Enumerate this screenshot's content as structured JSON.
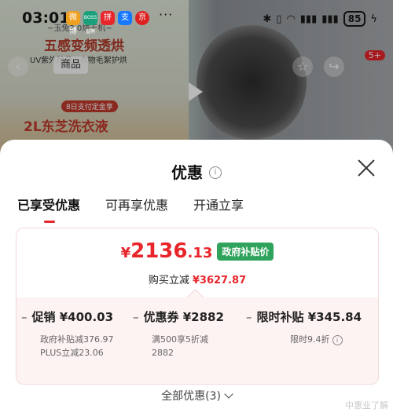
{
  "status_bar": {
    "time": "03:01",
    "apps": [
      "微博",
      "BOSS直聘",
      "拼",
      "支",
      "京"
    ],
    "more": "···",
    "battery": "85"
  },
  "background": {
    "promo_line1": "~玉兔2.0烘干机~",
    "promo_line2": "五感变频透烘",
    "promo_line3": "UV紫外除菌 · 衣物毛絮护烘",
    "tab_label": "商品",
    "promo_badge": "8日支付定金享",
    "promo_line4": "2L东芝洗衣液",
    "badge_count": "5+"
  },
  "sheet": {
    "title": "优惠",
    "info_icon": "i",
    "tabs": [
      {
        "label": "已享受优惠",
        "active": true
      },
      {
        "label": "可再享优惠",
        "active": false
      },
      {
        "label": "开通立享",
        "active": false
      }
    ],
    "price": {
      "currency": "¥",
      "integer": "2136",
      "decimal": ".13",
      "tag": "政府补贴价"
    },
    "savings": {
      "label": "购买立减",
      "amount": "¥3627.87"
    },
    "columns": [
      {
        "dash": "–",
        "title": "促销 ¥400.03",
        "details": [
          "政府补贴减376.97",
          "PLUS立减23.06"
        ]
      },
      {
        "dash": "–",
        "title": "优惠券 ¥2882",
        "details": [
          "满500享5折减",
          "2882"
        ]
      },
      {
        "dash": "–",
        "title": "限时补贴 ¥345.84",
        "details": [
          "限时9.4折"
        ]
      }
    ],
    "all_offers": "全部优惠(3)",
    "watermark": "中惠业了解"
  },
  "colors": {
    "accent_red": "#e8252b",
    "gov_green": "#2fa35b",
    "card_bg": "#fdf3f2"
  }
}
